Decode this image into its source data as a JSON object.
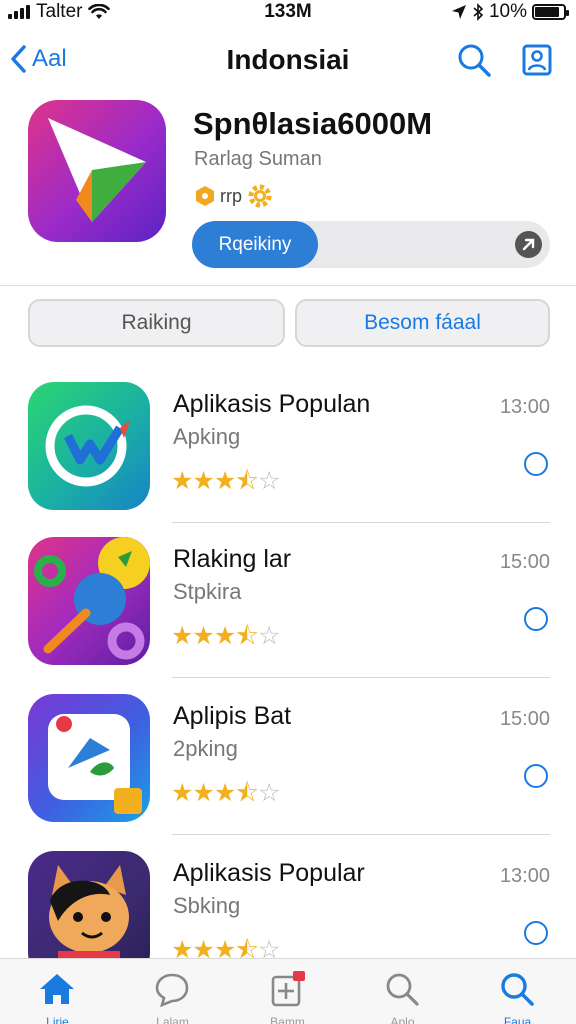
{
  "status_bar": {
    "carrier": "Talter",
    "time": "133M",
    "battery": "10%",
    "battery_level": 0.85
  },
  "nav": {
    "back_label": "Aal",
    "title": "Indonsiai"
  },
  "hero": {
    "title": "Spnθlasia6000M",
    "subtitle": "Rarlag Suman",
    "meta_text": "rrp",
    "button_label": "Rqeikiny"
  },
  "segments": {
    "left_label": "Raiking",
    "right_label": "Besom fáaal"
  },
  "apps": [
    {
      "name": "Aplikasis Populan",
      "subtitle": "Apking",
      "time": "13:00",
      "rating": 3.5
    },
    {
      "name": "Rlaking lar",
      "subtitle": "Stpkira",
      "time": "15:00",
      "rating": 3.5
    },
    {
      "name": "Aplipis Bat",
      "subtitle": "2pking",
      "time": "15:00",
      "rating": 3.5
    },
    {
      "name": "Aplikasis Popular",
      "subtitle": "Sbking",
      "time": "13:00",
      "rating": 3.5
    }
  ],
  "tabs": [
    {
      "label": "Lirie",
      "icon": "home-icon",
      "active": true
    },
    {
      "label": "Lalam",
      "icon": "chat-icon",
      "active": false
    },
    {
      "label": "Bamm",
      "icon": "add-icon",
      "active": false
    },
    {
      "label": "Aplo",
      "icon": "search-icon",
      "active": false
    },
    {
      "label": "Faua",
      "icon": "search-icon",
      "active": true
    }
  ],
  "colors": {
    "accent": "#1a7ae0",
    "star": "#f2b01e"
  }
}
